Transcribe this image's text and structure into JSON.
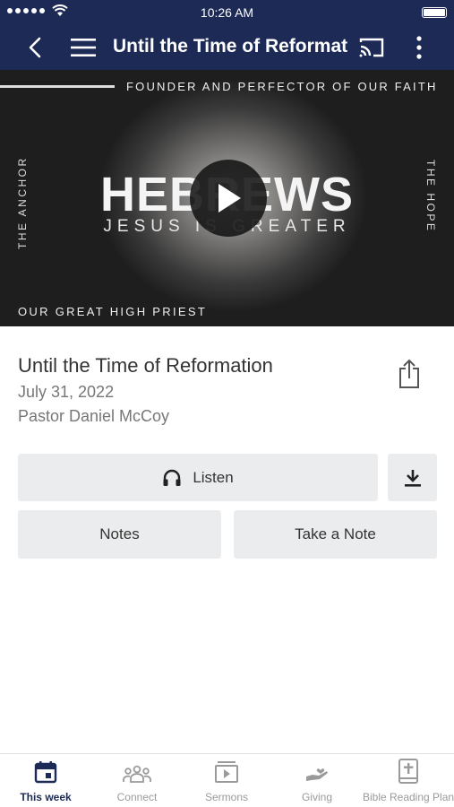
{
  "status_bar": {
    "time": "10:26 AM"
  },
  "nav": {
    "title": "Until the Time of Reformation..."
  },
  "hero": {
    "top_text": "FOUNDER AND PERFECTOR OF OUR FAITH",
    "left_side_text": "THE ANCHOR",
    "right_side_text": "THE HOPE",
    "title": "HEBREWS",
    "subtitle": "JESUS IS GREATER",
    "bottom_text": "OUR GREAT HIGH PRIEST"
  },
  "sermon": {
    "title": "Until the Time of Reformation",
    "date": "July 31, 2022",
    "speaker": "Pastor Daniel McCoy"
  },
  "actions": {
    "listen_label": "Listen",
    "notes_label": "Notes",
    "take_note_label": "Take a Note"
  },
  "tabs": [
    {
      "label": "This week",
      "icon": "calendar-icon",
      "active": true
    },
    {
      "label": "Connect",
      "icon": "people-icon",
      "active": false
    },
    {
      "label": "Sermons",
      "icon": "video-library-icon",
      "active": false
    },
    {
      "label": "Giving",
      "icon": "hand-heart-icon",
      "active": false
    },
    {
      "label": "Bible Reading Plan",
      "icon": "bible-icon",
      "active": false
    }
  ],
  "colors": {
    "header_bg": "#1c2a55",
    "button_bg": "#ebeced",
    "active_tab": "#1c2a55",
    "inactive_tab": "#9a9a9a"
  }
}
